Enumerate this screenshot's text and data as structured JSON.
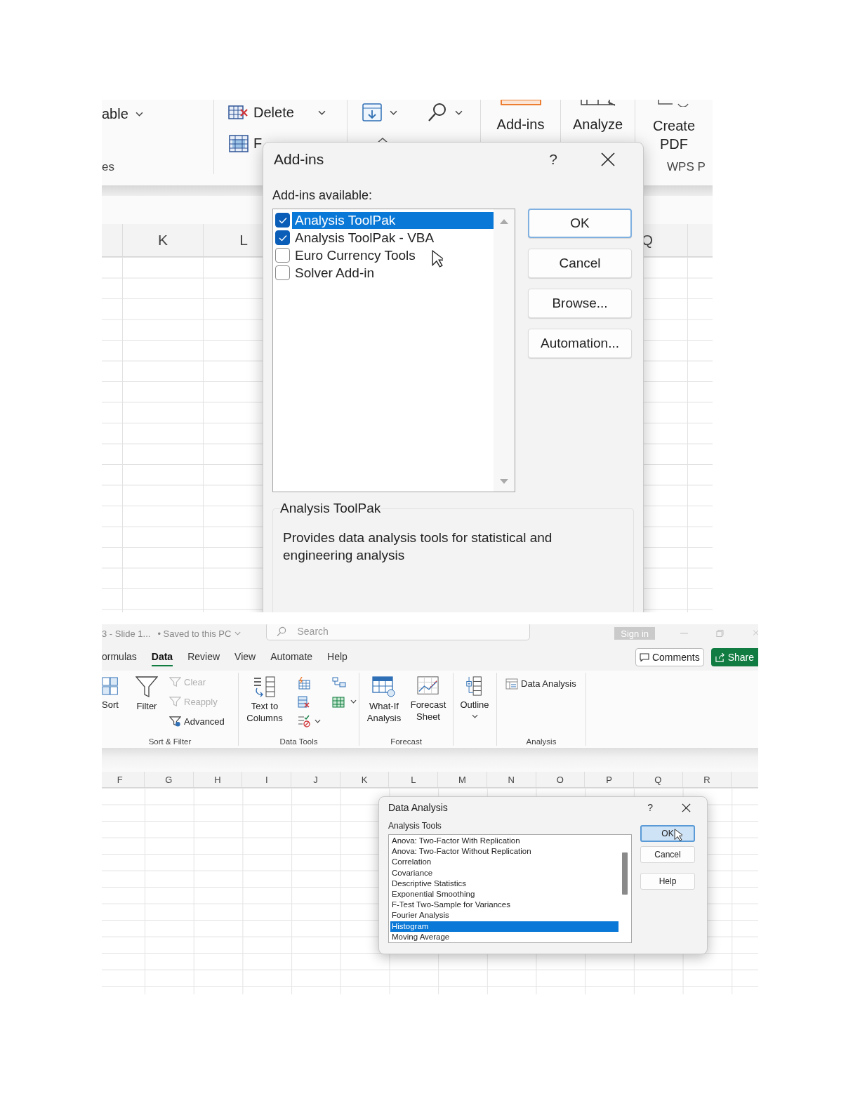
{
  "addins_screen": {
    "ribbon": {
      "table_label": "able",
      "table_group_label": "es",
      "delete": "Delete",
      "format": "F",
      "add_ins": "Add-ins",
      "analyze": "Analyze",
      "create_pdf": "Create\nPDF",
      "pdf_group_label": "WPS P"
    },
    "columns": [
      "K",
      "L",
      "Q"
    ],
    "dialog": {
      "title": "Add-ins",
      "help": "?",
      "list_label": "Add-ins available:",
      "items": [
        {
          "label": "Analysis ToolPak",
          "checked": true,
          "selected": true
        },
        {
          "label": "Analysis ToolPak - VBA",
          "checked": true,
          "selected": false
        },
        {
          "label": "Euro Currency Tools",
          "checked": false,
          "selected": false
        },
        {
          "label": "Solver Add-in",
          "checked": false,
          "selected": false
        }
      ],
      "buttons": [
        {
          "label": "OK",
          "default": true
        },
        {
          "label": "Cancel",
          "default": false
        },
        {
          "label": "Browse...",
          "default": false
        },
        {
          "label": "Automation...",
          "default": false
        }
      ],
      "description_title": "Analysis ToolPak",
      "description": "Provides data analysis tools for statistical and engineering analysis"
    }
  },
  "data_analysis_screen": {
    "title_bar": {
      "document": "3 - Slide 1...",
      "save_status": "• Saved to this PC",
      "search_placeholder": "Search",
      "sign_in": "Sign in"
    },
    "tabs": [
      {
        "label": "ormulas",
        "selected": false
      },
      {
        "label": "Data",
        "selected": true
      },
      {
        "label": "Review",
        "selected": false
      },
      {
        "label": "View",
        "selected": false
      },
      {
        "label": "Automate",
        "selected": false
      },
      {
        "label": "Help",
        "selected": false
      }
    ],
    "comments": "Comments",
    "share": "Share",
    "ribbon": {
      "sort": "Sort",
      "filter": "Filter",
      "filter_commands": [
        {
          "label": "Clear",
          "disabled": true
        },
        {
          "label": "Reapply",
          "disabled": true
        },
        {
          "label": "Advanced",
          "disabled": false
        }
      ],
      "sort_filter_label": "Sort & Filter",
      "text_to_columns": "Text to\nColumns",
      "data_tools_label": "Data Tools",
      "what_if": "What-If\nAnalysis",
      "forecast_sheet": "Forecast\nSheet",
      "forecast_label": "Forecast",
      "outline": "Outline",
      "data_analysis": "Data Analysis",
      "analysis_label": "Analysis"
    },
    "columns": [
      "F",
      "G",
      "H",
      "I",
      "J",
      "K",
      "L",
      "M",
      "N",
      "O",
      "P",
      "Q",
      "R"
    ],
    "dialog": {
      "title": "Data Analysis",
      "help": "?",
      "list_label": "Analysis Tools",
      "tools": [
        {
          "label": "Anova: Two-Factor With Replication",
          "selected": false
        },
        {
          "label": "Anova: Two-Factor Without Replication",
          "selected": false
        },
        {
          "label": "Correlation",
          "selected": false
        },
        {
          "label": "Covariance",
          "selected": false
        },
        {
          "label": "Descriptive Statistics",
          "selected": false
        },
        {
          "label": "Exponential Smoothing",
          "selected": false
        },
        {
          "label": "F-Test Two-Sample for Variances",
          "selected": false
        },
        {
          "label": "Fourier Analysis",
          "selected": false
        },
        {
          "label": "Histogram",
          "selected": true
        },
        {
          "label": "Moving Average",
          "selected": false
        }
      ],
      "buttons": [
        {
          "label": "OK",
          "default": true
        },
        {
          "label": "Cancel",
          "default": false
        },
        {
          "label": "Help",
          "default": false
        }
      ]
    }
  }
}
